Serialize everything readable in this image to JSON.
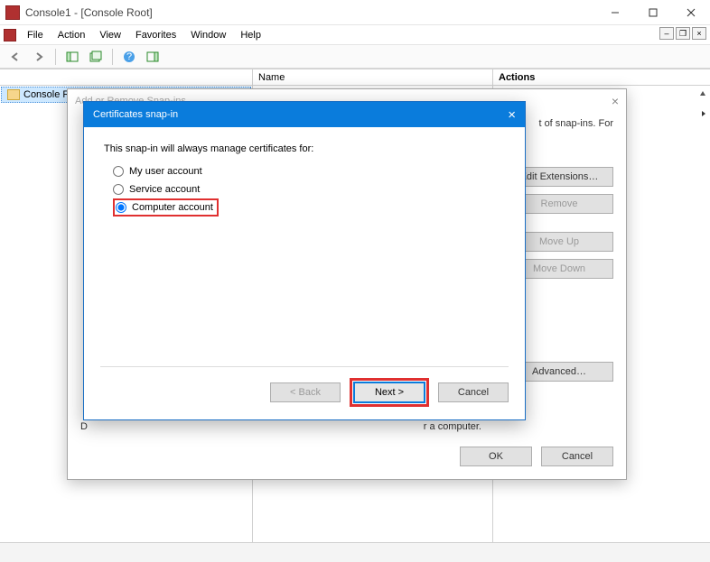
{
  "window": {
    "title": "Console1 - [Console Root]",
    "menus": [
      "File",
      "Action",
      "View",
      "Favorites",
      "Window",
      "Help"
    ]
  },
  "tree": {
    "root_label": "Console Root"
  },
  "center": {
    "name_header": "Name"
  },
  "actions": {
    "header": "Actions"
  },
  "addremove": {
    "title": "Add or Remove Snap-ins",
    "intro_fragment": "t of snap-ins. For",
    "buttons": {
      "edit_ext": "Edit Extensions…",
      "remove": "Remove",
      "move_up": "Move Up",
      "move_down": "Move Down",
      "advanced": "Advanced…",
      "ok": "OK",
      "cancel": "Cancel"
    },
    "desc_prefix": "D",
    "desc_suffix": "r a computer."
  },
  "wizard": {
    "title": "Certificates snap-in",
    "prompt": "This snap-in will always manage certificates for:",
    "options": {
      "user": "My user account",
      "service": "Service account",
      "computer": "Computer account"
    },
    "buttons": {
      "back": "< Back",
      "next": "Next >",
      "cancel": "Cancel"
    },
    "selected": "computer"
  }
}
